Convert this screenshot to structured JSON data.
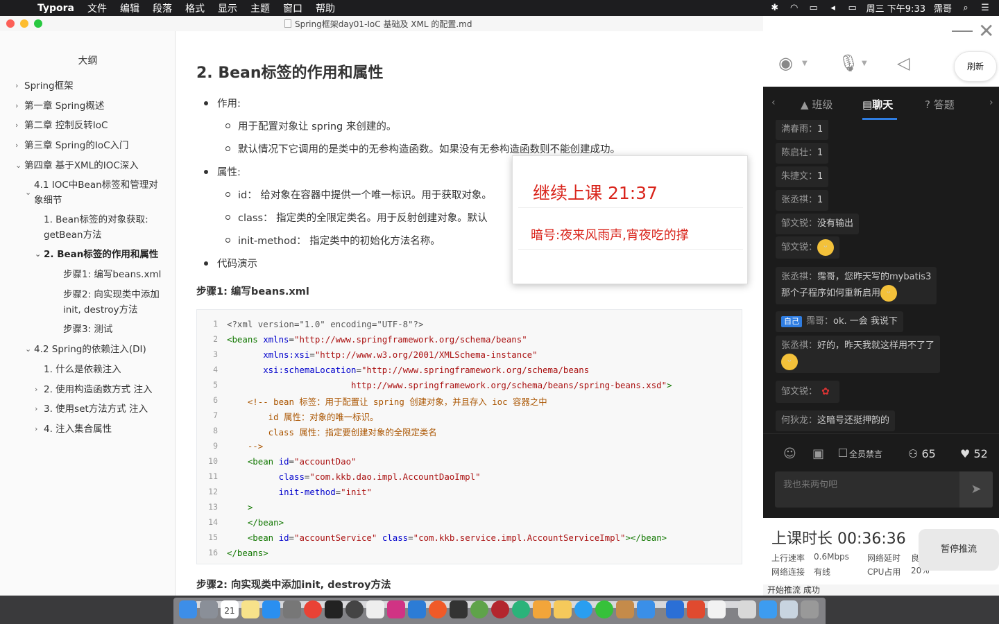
{
  "menubar": {
    "app": "Typora",
    "items": [
      "文件",
      "编辑",
      "段落",
      "格式",
      "显示",
      "主题",
      "窗口",
      "帮助"
    ],
    "clock": "周三 下午9:33",
    "user": "霈哥"
  },
  "window": {
    "title": "Spring框架day01-IoC 基础及 XML 的配置.md"
  },
  "sidebar": {
    "title": "大纲",
    "items": [
      "Spring框架",
      "第一章 Spring概述",
      "第二章 控制反转IoC",
      "第三章 Spring的IoC入门",
      "第四章 基于XML的IOC深入",
      "4.1 IOC中Bean标签和管理对",
      "象细节",
      "1. Bean标签的对象获取:",
      "getBean方法",
      "2. Bean标签的作用和属性",
      "步骤1: 编写beans.xml",
      "步骤2: 向实现类中添加",
      "init, destroy方法",
      "步骤3: 测试",
      "4.2 Spring的依赖注入(DI)",
      "1. 什么是依赖注入",
      "2. 使用构造函数方式 注入",
      "3. 使用set方法方式 注入",
      "4. 注入集合属性"
    ]
  },
  "doc": {
    "heading": "2. Bean标签的作用和属性",
    "b1": "作用:",
    "b1_1": "用于配置对象让 spring 来创建的。",
    "b1_2": "默认情况下它调用的是类中的无参构造函数。如果没有无参构造函数则不能创建成功。",
    "b2": "属性:",
    "b2_1": "id： 给对象在容器中提供一个唯一标识。用于获取对象。",
    "b2_2": "class： 指定类的全限定类名。用于反射创建对象。默认",
    "b2_3": "init-method： 指定类中的初始化方法名称。",
    "b3": "代码演示",
    "step1": "步骤1: 编写beans.xml",
    "step2": "步骤2: 向实现类中添加init, destroy方法",
    "line_numbers": [
      "1",
      "2",
      "3",
      "4",
      "5",
      "6",
      "7",
      "8",
      "9",
      "10",
      "11",
      "12",
      "13",
      "14",
      "15",
      "16"
    ]
  },
  "popup": {
    "title": "继续上课  21:37",
    "content": "暗号:夜来风雨声,宵夜吃的撑"
  },
  "live": {
    "refresh": "刷新",
    "tabs": [
      "班级",
      "聊天",
      "答题"
    ],
    "messages": [
      {
        "name": "满春雨：",
        "text": "1"
      },
      {
        "name": "陈启壮：",
        "text": "1"
      },
      {
        "name": "朱捷文：",
        "text": "1"
      },
      {
        "name": "张丞祺：",
        "text": "1"
      },
      {
        "name": "邹文锐：",
        "text": "没有输出"
      },
      {
        "name": "邹文锐：",
        "text": ""
      },
      {
        "name": "张丞祺：",
        "text": "霈哥，您昨天写的mybatis3"
      },
      {
        "name": "",
        "text": "那个子程序如何重新启用"
      },
      {
        "name": "霈哥：",
        "text": "ok. 一会 我说下",
        "badge": "自己"
      },
      {
        "name": "张丞祺：",
        "text": "好的，昨天我就这样用不了了"
      },
      {
        "name": "邹文锐：",
        "text": ""
      },
      {
        "name": "何狄龙：",
        "text": "这暗号还挺押韵的"
      }
    ],
    "mute_all": "全员禁言",
    "online": "65",
    "likes": "52",
    "input_placeholder": "我也来两句吧",
    "duration_label": "上课时长 00:36:36",
    "upload_label": "上行速率",
    "upload": "0.6Mbps",
    "latency_label": "网络延时",
    "latency": "良",
    "net_label": "网络连接",
    "net": "有线",
    "cpu_label": "CPU占用",
    "cpu": "20%",
    "pause": "暂停推流",
    "push_status": "开始推流  成功"
  },
  "dock": {
    "calendar_day": "21"
  }
}
